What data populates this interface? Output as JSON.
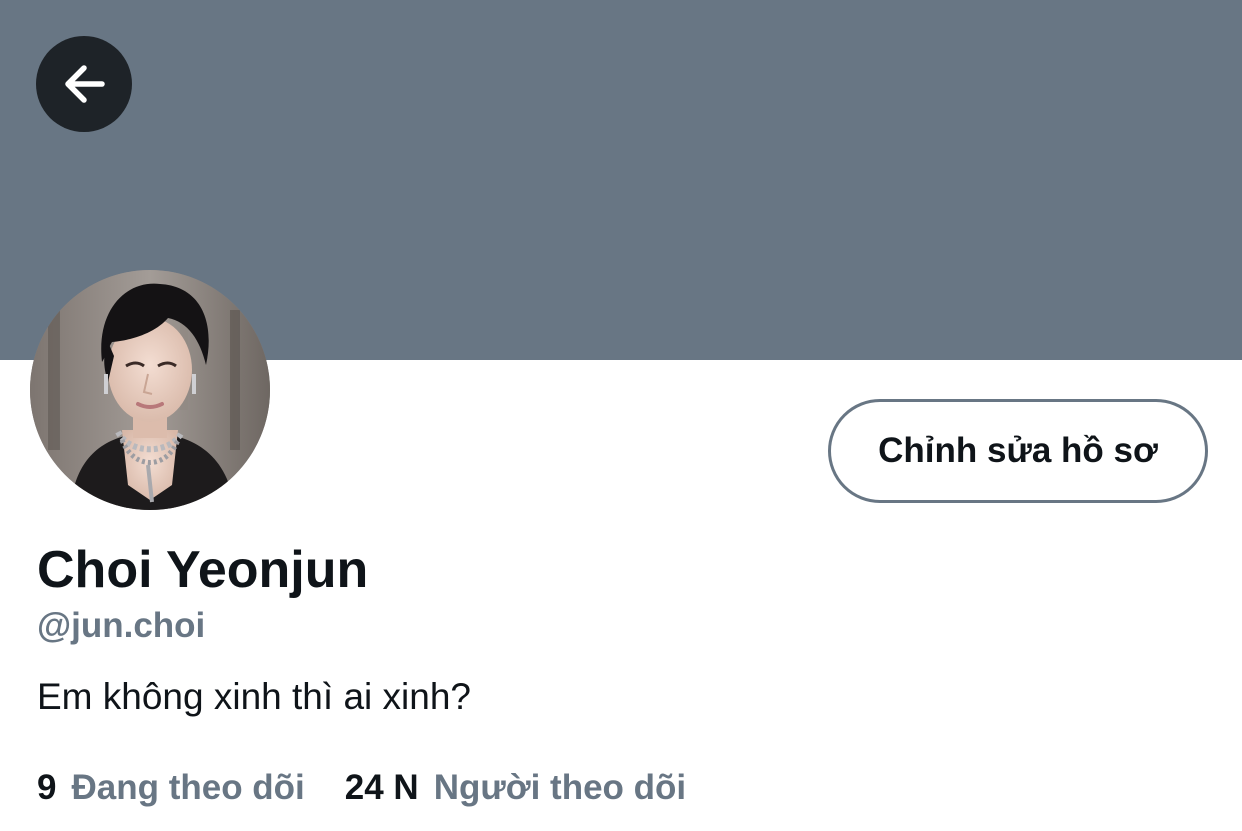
{
  "colors": {
    "banner": "#687684",
    "back_button_bg": "#1e2328",
    "primary_text": "#0f1419",
    "secondary_text": "#687684",
    "button_border": "#687684"
  },
  "header": {
    "back_icon": "arrow-left-icon"
  },
  "profile": {
    "avatar_icon": "profile-photo",
    "edit_button_label": "Chỉnh sửa hồ sơ",
    "display_name": "Choi Yeonjun",
    "handle": "@jun.choi",
    "bio": "Em không xinh thì ai xinh?"
  },
  "stats": {
    "following_count": "9",
    "following_label": "Đang theo dõi",
    "followers_count": "24 N",
    "followers_label": "Người theo dõi"
  }
}
